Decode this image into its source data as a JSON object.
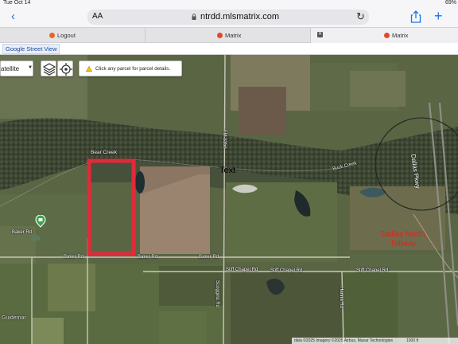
{
  "status_bar": {
    "time": "Tue Oct 14",
    "battery": "69%"
  },
  "browser": {
    "url": "ntrdd.mlsmatrix.com",
    "aa_label": "AA",
    "tabs": [
      {
        "label": "Logout"
      },
      {
        "label": "Matrix"
      },
      {
        "label": "Matrix"
      }
    ]
  },
  "page": {
    "street_view_label": "Google Street View"
  },
  "map_controls": {
    "map_type": "atellite",
    "hint": "Click any parcel for parcel details."
  },
  "map_labels": {
    "bear_creek": "Bear Creek",
    "buck_creek": "Buck Creek",
    "baker_rd_w": "Baker Rd",
    "baker_rd_sw": "Baker Rd",
    "baker_rd_center": "Baker Rd",
    "baker_rd_east": "Baker Rd",
    "stiff_chapel_1": "Stiff Chapel Rd",
    "stiff_chapel_2": "Stiff Chapel Rd",
    "stiff_chapel_3": "Stiff Chapel Rd",
    "fm_road": "FM 3356",
    "snuggins_rd": "Scoggins Rd",
    "hanna_rd": "Hanna Rd",
    "text_annotation": "Text",
    "dallas_north_tollway": "Dallas North Tollway",
    "dallas_pkwy": "Dallas Pkwy",
    "watermark": "Guidemar",
    "attribution": "data ©2025 Imagery ©2025 Airbus, Maxar Technologies",
    "scale": "1000 ft"
  },
  "colors": {
    "accent": "#1a73e8",
    "parcel_outline": "#e8283a",
    "annotation_red": "#e52020",
    "marker_green": "#3aa54a"
  }
}
